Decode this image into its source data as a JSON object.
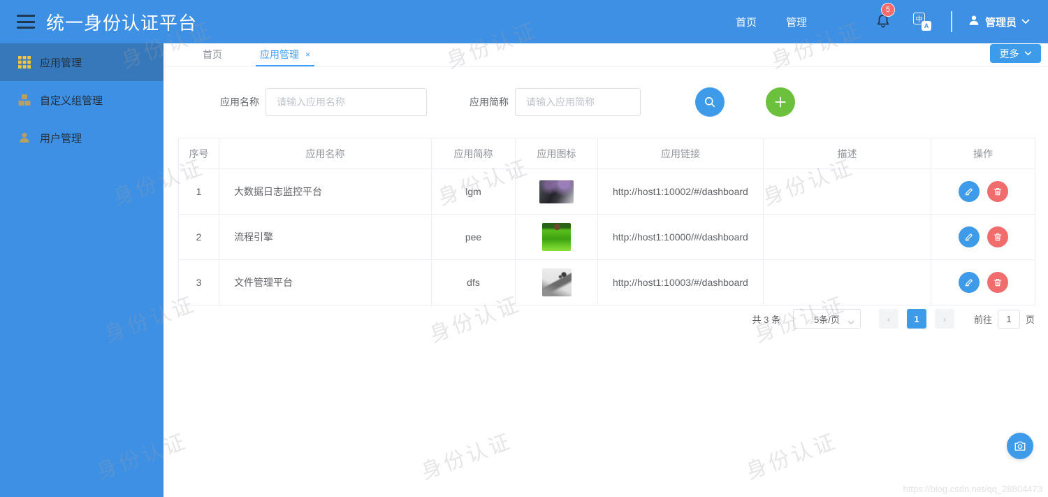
{
  "header": {
    "title": "统一身份认证平台",
    "nav": [
      {
        "label": "首页"
      },
      {
        "label": "管理"
      }
    ],
    "notification_count": "5",
    "user": {
      "name": "管理员"
    }
  },
  "sidebar": {
    "items": [
      {
        "label": "应用管理",
        "icon": "grid-icon",
        "active": true
      },
      {
        "label": "自定义组管理",
        "icon": "group-icon",
        "active": false
      },
      {
        "label": "用户管理",
        "icon": "user-icon",
        "active": false
      }
    ]
  },
  "tabs": [
    {
      "label": "首页",
      "active": false,
      "closable": false
    },
    {
      "label": "应用管理",
      "active": true,
      "closable": true
    }
  ],
  "more_button": "更多",
  "search_form": {
    "name_label": "应用名称",
    "name_placeholder": "请输入应用名称",
    "abbr_label": "应用简称",
    "abbr_placeholder": "请输入应用简称"
  },
  "table": {
    "columns": [
      "序号",
      "应用名称",
      "应用简称",
      "应用图标",
      "应用链接",
      "描述",
      "操作"
    ],
    "rows": [
      {
        "index": "1",
        "name": "大数据日志监控平台",
        "abbr": "lgm",
        "icon": "night-purple-trees-photo",
        "link": "http://host1:10002/#/dashboard",
        "desc": ""
      },
      {
        "index": "2",
        "name": "流程引擎",
        "abbr": "pee",
        "icon": "green-field-photo",
        "link": "http://host1:10000/#/dashboard",
        "desc": ""
      },
      {
        "index": "3",
        "name": "文件管理平台",
        "abbr": "dfs",
        "icon": "gray-roof-photo",
        "link": "http://host1:10003/#/dashboard",
        "desc": ""
      }
    ]
  },
  "pagination": {
    "total": "共 3 条",
    "page_size": "5条/页",
    "prev": "‹",
    "current_page": "1",
    "next": "›",
    "goto_label": "前往",
    "goto_value": "1",
    "page_unit": "页"
  },
  "lang_icon": {
    "back": "中",
    "front": "A"
  },
  "watermark": {
    "text": "身份认证",
    "url_text": "https://blog.csdn.net/qq_28804473"
  },
  "colors": {
    "primary": "#3d90e4",
    "accent": "#409eff",
    "success": "#6bc13b",
    "danger": "#f16d6d",
    "badge": "#f56c6c"
  }
}
